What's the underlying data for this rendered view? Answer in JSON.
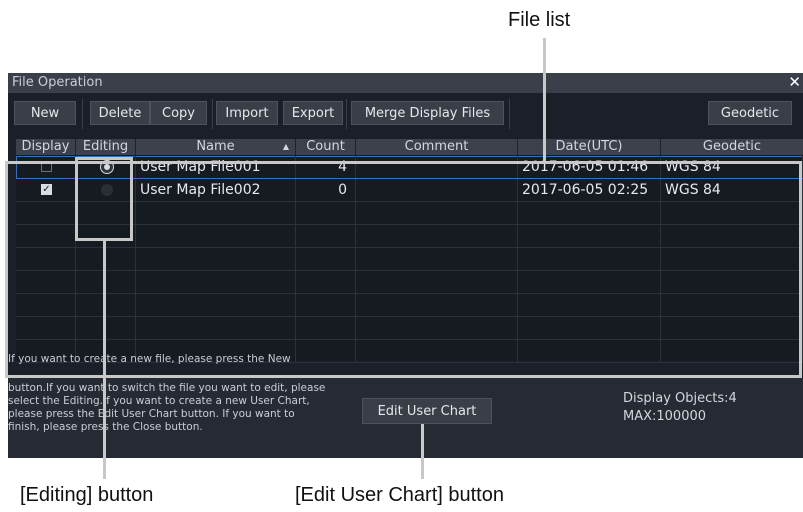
{
  "callouts": {
    "file_list": "File list",
    "editing_button": "[Editing] button",
    "edit_user_chart_button": "[Edit User Chart] button"
  },
  "window": {
    "title": "File Operation",
    "close_glyph": "✕"
  },
  "toolbar": {
    "new": "New",
    "delete": "Delete",
    "copy": "Copy",
    "import": "Import",
    "export": "Export",
    "merge": "Merge Display Files",
    "geodetic": "Geodetic"
  },
  "table": {
    "headers": {
      "display": "Display",
      "editing": "Editing",
      "name": "Name",
      "sort_indicator": "▲",
      "count": "Count",
      "comment": "Comment",
      "date": "Date(UTC)",
      "geodetic": "Geodetic"
    },
    "rows": [
      {
        "display": false,
        "editing": true,
        "name": "User Map File001",
        "count": "4",
        "comment": "",
        "date": "2017-06-05 01:46",
        "geodetic": "WGS 84"
      },
      {
        "display": true,
        "editing": false,
        "name": "User Map File002",
        "count": "0",
        "comment": "",
        "date": "2017-06-05 02:25",
        "geodetic": "WGS 84"
      }
    ],
    "empty_rows": 7
  },
  "help": {
    "line0": "If you want to create a new file, please press the New",
    "line1": "button.If you want to switch the file you want to edit, please",
    "line2": "select the Editing.If you want to create a new User Chart,",
    "line3": "please press the Edit User Chart button. If you want to",
    "line4": "finish, please press the Close button."
  },
  "footer": {
    "edit_user_chart": "Edit User Chart",
    "display_objects": "Display Objects:4",
    "max": "MAX:100000"
  }
}
